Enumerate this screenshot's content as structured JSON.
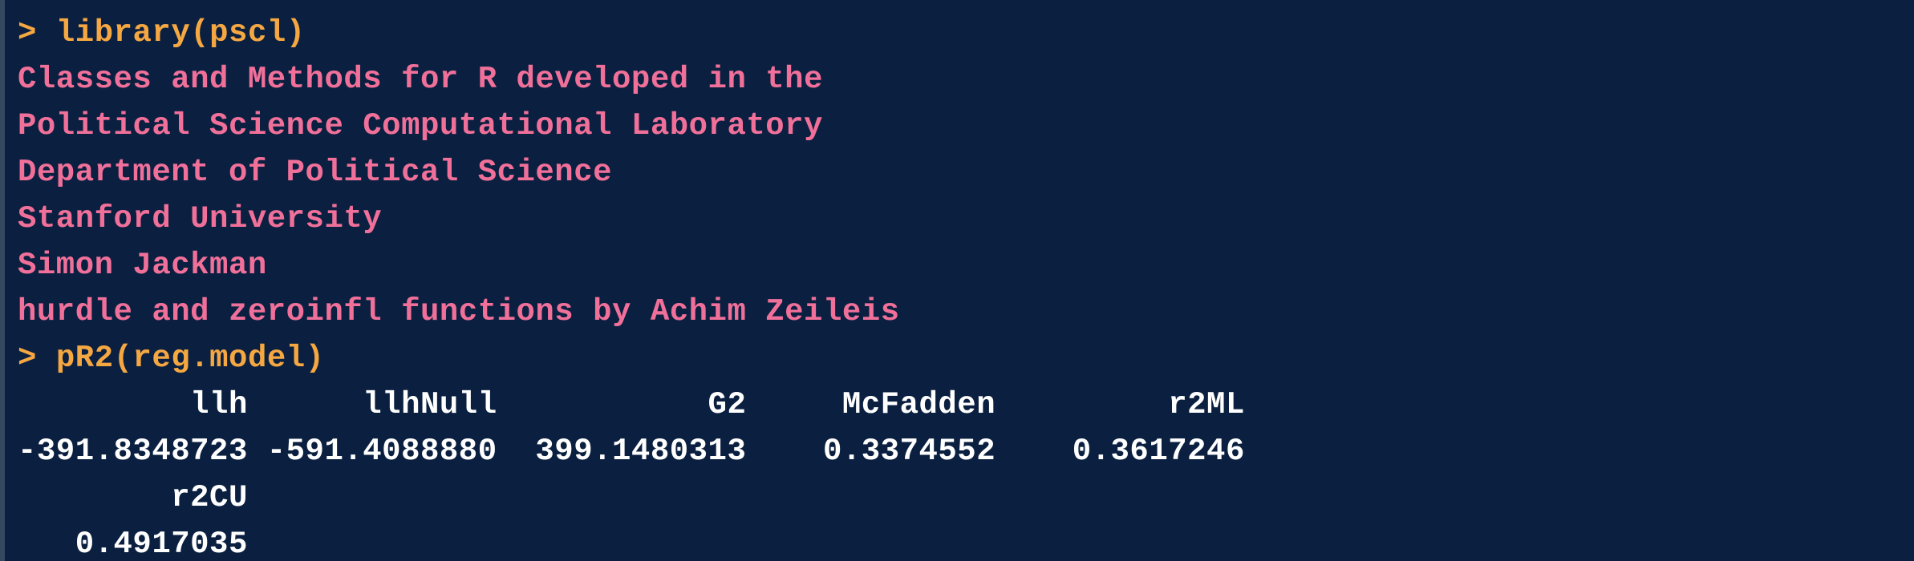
{
  "console": {
    "prompt": ">",
    "commands": [
      "library(pscl)",
      "pR2(reg.model)"
    ],
    "messages": [
      "Classes and Methods for R developed in the",
      "Political Science Computational Laboratory",
      "Department of Political Science",
      "Stanford University",
      "Simon Jackman",
      "hurdle and zeroinfl functions by Achim Zeileis"
    ],
    "output": [
      "         llh      llhNull           G2     McFadden         r2ML",
      "-391.8348723 -591.4088880  399.1480313    0.3374552    0.3617246",
      "        r2CU",
      "   0.4917035"
    ]
  },
  "colors": {
    "background": "#0b2040",
    "prompt": "#f5a742",
    "message": "#f0709a",
    "output": "#ffffff"
  }
}
